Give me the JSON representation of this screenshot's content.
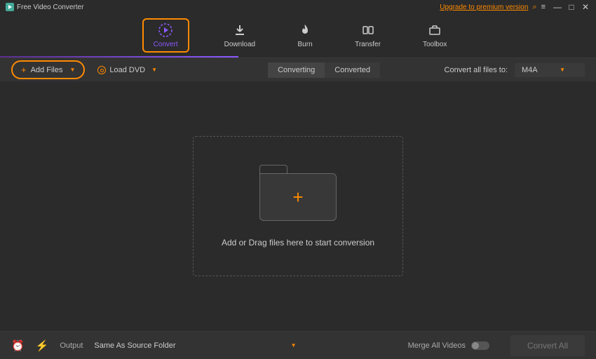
{
  "titlebar": {
    "app_title": "Free Video Converter",
    "upgrade_label": "Upgrade to premium version"
  },
  "nav": {
    "items": [
      {
        "label": "Convert"
      },
      {
        "label": "Download"
      },
      {
        "label": "Burn"
      },
      {
        "label": "Transfer"
      },
      {
        "label": "Toolbox"
      }
    ]
  },
  "toolbar": {
    "add_files_label": "Add Files",
    "load_dvd_label": "Load DVD",
    "tab_converting": "Converting",
    "tab_converted": "Converted",
    "convert_to_label": "Convert all files to:",
    "format_selected": "M4A"
  },
  "dropzone": {
    "text": "Add or Drag files here to start conversion"
  },
  "footer": {
    "output_label": "Output",
    "output_value": "Same As Source Folder",
    "merge_label": "Merge All Videos",
    "convert_all_label": "Convert All"
  },
  "colors": {
    "accent_orange": "#ff8a00",
    "accent_purple": "#8a5aff",
    "bg_dark": "#2b2b2b"
  }
}
